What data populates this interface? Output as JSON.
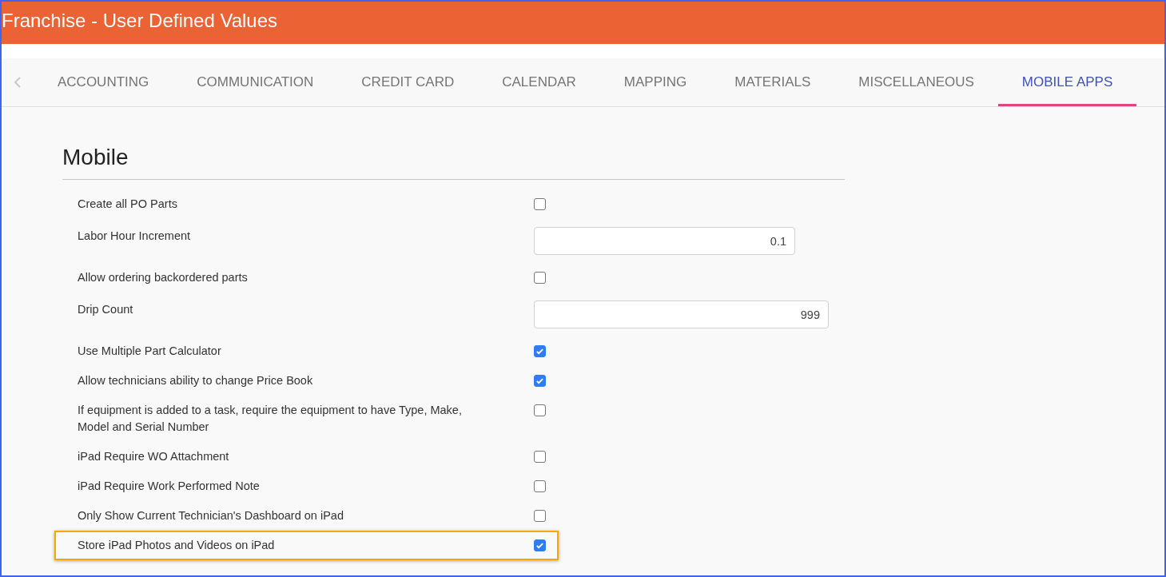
{
  "window": {
    "title": "Franchise - User Defined Values"
  },
  "tabs": [
    {
      "label": "ACCOUNTING",
      "selected": false
    },
    {
      "label": "COMMUNICATION",
      "selected": false
    },
    {
      "label": "CREDIT CARD",
      "selected": false
    },
    {
      "label": "CALENDAR",
      "selected": false
    },
    {
      "label": "MAPPING",
      "selected": false
    },
    {
      "label": "MATERIALS",
      "selected": false
    },
    {
      "label": "MISCELLANEOUS",
      "selected": false
    },
    {
      "label": "MOBILE APPS",
      "selected": true
    }
  ],
  "section": {
    "heading": "Mobile"
  },
  "settings": [
    {
      "kind": "checkbox",
      "label": "Create all PO Parts",
      "checked": false,
      "highlighted": false
    },
    {
      "kind": "input",
      "label": "Labor Hour Increment",
      "value": "0.1"
    },
    {
      "kind": "checkbox",
      "label": "Allow ordering backordered parts",
      "checked": false,
      "highlighted": false
    },
    {
      "kind": "input",
      "label": "Drip Count",
      "value": "999"
    },
    {
      "kind": "checkbox",
      "label": "Use Multiple Part Calculator",
      "checked": true,
      "highlighted": false
    },
    {
      "kind": "checkbox",
      "label": "Allow technicians ability to change Price Book",
      "checked": true,
      "highlighted": false
    },
    {
      "kind": "checkbox",
      "label": "If equipment is added to a task, require the equipment to have Type, Make, Model and Serial Number",
      "checked": false,
      "highlighted": false
    },
    {
      "kind": "checkbox",
      "label": "iPad Require WO Attachment",
      "checked": false,
      "highlighted": false
    },
    {
      "kind": "checkbox",
      "label": "iPad Require Work Performed Note",
      "checked": false,
      "highlighted": false
    },
    {
      "kind": "checkbox",
      "label": "Only Show Current Technician's Dashboard on iPad",
      "checked": false,
      "highlighted": false
    },
    {
      "kind": "checkbox",
      "label": "Store iPad Photos and Videos on iPad",
      "checked": true,
      "highlighted": true
    }
  ]
}
